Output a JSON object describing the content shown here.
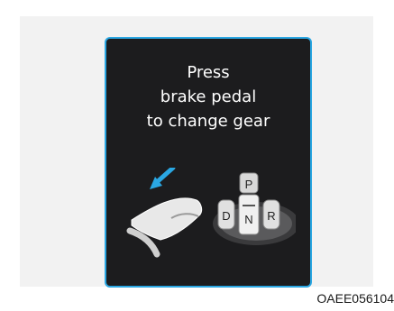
{
  "display": {
    "message_lines": [
      "Press",
      "brake pedal",
      "to change gear"
    ],
    "gear_buttons": {
      "p": "P",
      "d": "D",
      "n": "N",
      "r": "R"
    },
    "accent_color": "#2aa7e3",
    "screen_color": "#1c1c1e"
  },
  "icons": [
    "brake-pedal-icon",
    "press-arrow-icon",
    "gear-selector-icon"
  ],
  "figure_code": "OAEE056104"
}
